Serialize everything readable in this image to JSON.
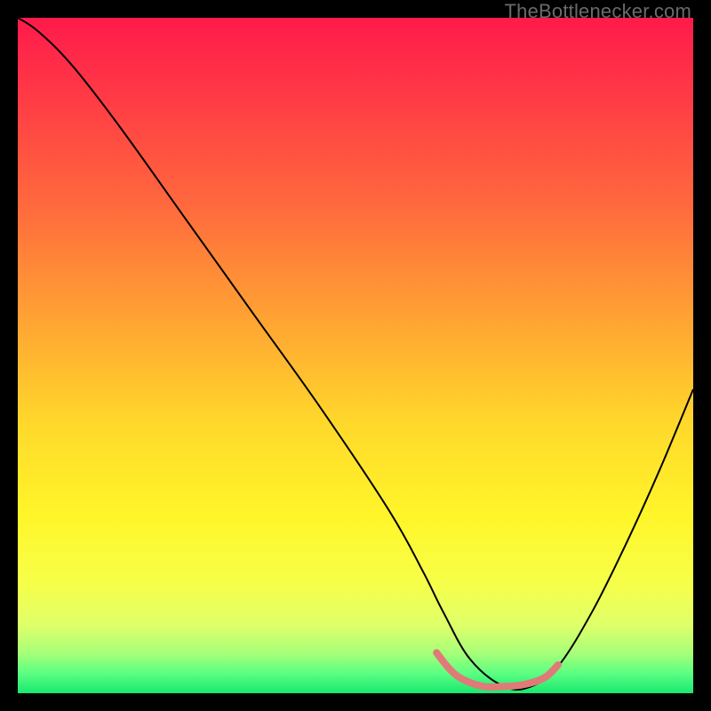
{
  "watermark": "TheBottlenecker.com",
  "chart_data": {
    "type": "line",
    "title": "",
    "xlabel": "",
    "ylabel": "",
    "xlim": [
      0,
      100
    ],
    "ylim": [
      0,
      100
    ],
    "background_gradient": {
      "stops": [
        {
          "pos": 0.0,
          "color": "#ff1a4b"
        },
        {
          "pos": 0.12,
          "color": "#ff3b45"
        },
        {
          "pos": 0.28,
          "color": "#ff6a3d"
        },
        {
          "pos": 0.44,
          "color": "#ffa133"
        },
        {
          "pos": 0.6,
          "color": "#ffd82b"
        },
        {
          "pos": 0.74,
          "color": "#fff62a"
        },
        {
          "pos": 0.84,
          "color": "#f6ff4a"
        },
        {
          "pos": 0.9,
          "color": "#deff6a"
        },
        {
          "pos": 0.94,
          "color": "#a8ff78"
        },
        {
          "pos": 0.97,
          "color": "#5dff82"
        },
        {
          "pos": 1.0,
          "color": "#18e870"
        }
      ]
    },
    "series": [
      {
        "name": "bottleneck-curve",
        "color": "#000000",
        "width": 2.0,
        "x": [
          0,
          3,
          8,
          15,
          25,
          35,
          45,
          55,
          60,
          63,
          67,
          72,
          76,
          80,
          85,
          90,
          95,
          100
        ],
        "values": [
          100,
          98,
          93,
          84,
          70,
          56,
          42,
          27,
          18,
          12,
          5,
          1,
          1,
          4,
          12,
          22,
          33,
          45
        ]
      },
      {
        "name": "sweet-spot",
        "color": "#e07a78",
        "width": 8.0,
        "x": [
          62,
          64,
          66,
          69,
          72,
          75,
          78,
          80
        ],
        "values": [
          6,
          3.5,
          2,
          1,
          1,
          1.3,
          2.3,
          4.2
        ]
      }
    ]
  }
}
